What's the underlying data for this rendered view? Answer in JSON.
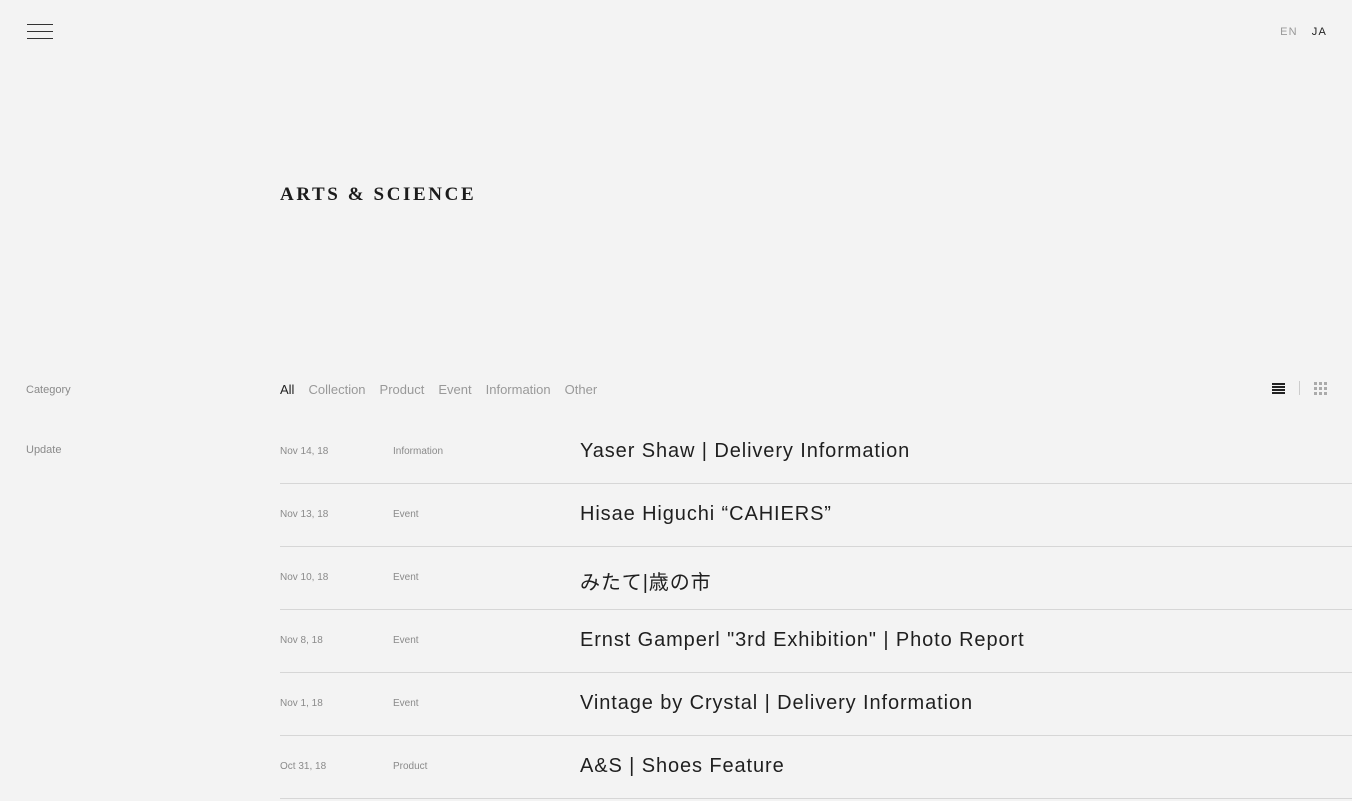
{
  "header": {
    "lang_en": "EN",
    "lang_ja": "JA",
    "menu_icon": "hamburger-icon"
  },
  "brand": {
    "logo_text": "ARTS & SCIENCE"
  },
  "sidebar": {
    "category_label": "Category",
    "update_label": "Update"
  },
  "filters": [
    {
      "label": "All",
      "active": true
    },
    {
      "label": "Collection",
      "active": false
    },
    {
      "label": "Product",
      "active": false
    },
    {
      "label": "Event",
      "active": false
    },
    {
      "label": "Information",
      "active": false
    },
    {
      "label": "Other",
      "active": false
    }
  ],
  "view_toggle": {
    "list_icon": "list-view-icon",
    "grid_icon": "grid-view-icon",
    "active": "list"
  },
  "posts": [
    {
      "date": "Nov 14, 18",
      "category": "Information",
      "title": "Yaser Shaw | Delivery Information"
    },
    {
      "date": "Nov 13, 18",
      "category": "Event",
      "title": "Hisae Higuchi “CAHIERS”"
    },
    {
      "date": "Nov 10, 18",
      "category": "Event",
      "title": "みたて|歳の市"
    },
    {
      "date": "Nov 8, 18",
      "category": "Event",
      "title": "Ernst Gamperl \"3rd Exhibition\" | Photo Report"
    },
    {
      "date": "Nov 1, 18",
      "category": "Event",
      "title": "Vintage by Crystal | Delivery Information"
    },
    {
      "date": "Oct 31, 18",
      "category": "Product",
      "title": "A&S | Shoes Feature"
    }
  ]
}
